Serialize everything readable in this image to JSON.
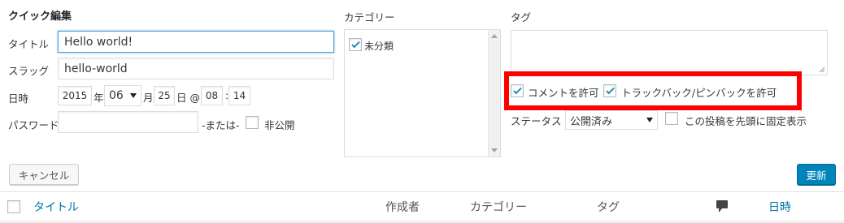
{
  "quick_edit": {
    "title": "クイック編集",
    "title_label": "タイトル",
    "title_value": "Hello world!",
    "slug_label": "スラッグ",
    "slug_value": "hello-world",
    "date_label": "日時",
    "year": "2015",
    "year_suffix": "年",
    "month": "06",
    "month_suffix": "月",
    "day": "25",
    "day_suffix": "日 @",
    "hour": "08",
    "time_sep": ":",
    "minute": "14",
    "password_label": "パスワード",
    "password_value": "",
    "or_label": "-または-",
    "private_label": "非公開",
    "private_checked": false
  },
  "category": {
    "label": "カテゴリー",
    "items": [
      {
        "label": "未分類",
        "checked": true
      }
    ]
  },
  "tags": {
    "label": "タグ",
    "value": ""
  },
  "options": {
    "allow_comments_label": "コメントを許可",
    "allow_comments_checked": true,
    "allow_pings_label": "トラックバック/ピンバックを許可",
    "allow_pings_checked": true,
    "highlight_color": "#ff0000"
  },
  "status": {
    "label": "ステータス",
    "value": "公開済み",
    "sticky_label": "この投稿を先頭に固定表示",
    "sticky_checked": false
  },
  "buttons": {
    "cancel": "キャンセル",
    "update": "更新"
  },
  "table_header": {
    "columns": [
      "タイトル",
      "作成者",
      "カテゴリー",
      "タグ",
      "comment-icon",
      "日時"
    ]
  },
  "colors": {
    "accent": "#0085ba",
    "link": "#0073aa",
    "check": "#1e8cbe"
  }
}
